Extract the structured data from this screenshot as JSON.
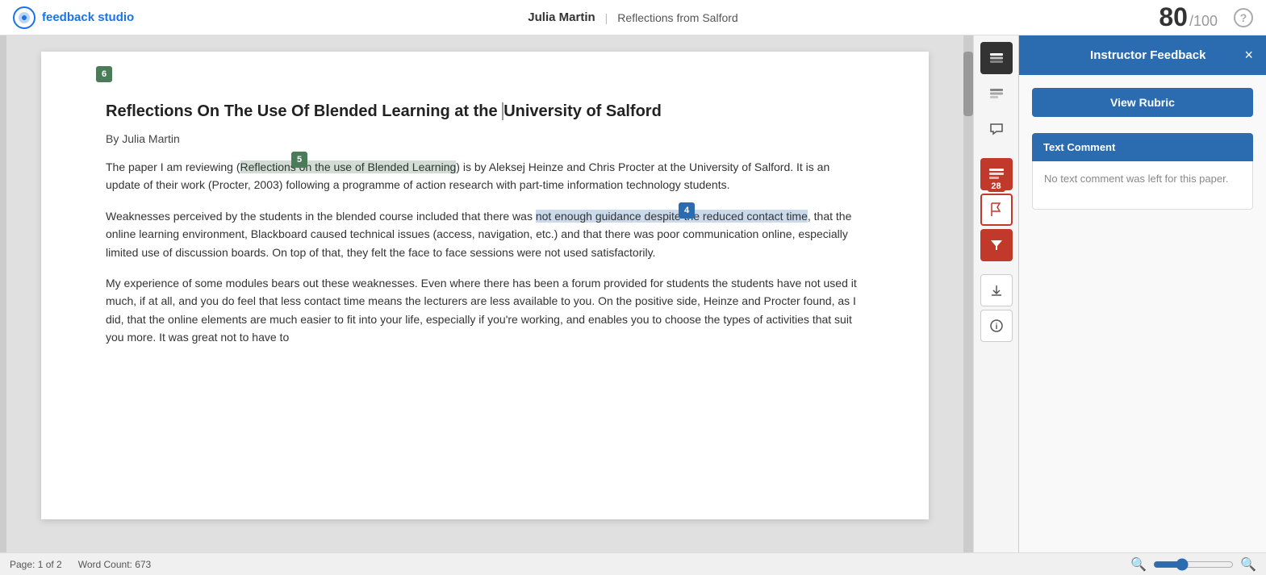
{
  "header": {
    "logo_text": "feedback studio",
    "student_name": "Julia Martin",
    "doc_title": "Reflections from Salford",
    "score": "80",
    "score_total": "/100"
  },
  "toolbar": {
    "layers_icon": "⊞",
    "comments_icon": "💬",
    "rubric_icon": "📊",
    "flag_icon": "⚑",
    "filter_icon": "▼",
    "download_icon": "⬇",
    "info_icon": "ⓘ",
    "badge_count": "28"
  },
  "right_panel": {
    "title": "Instructor Feedback",
    "close_label": "×",
    "view_rubric_label": "View Rubric",
    "text_comment_label": "Text Comment",
    "no_comment_text": "No text comment was left for this paper."
  },
  "document": {
    "badge6_label": "6",
    "badge5_label": "5",
    "badge4_label": "4",
    "title": "Reflections On The Use Of Blended Learning at the University of Salford",
    "author": "By Julia Martin",
    "paragraph1_pre": "The paper I am reviewing (",
    "paragraph1_highlight1": "Reflections on the use of Blended Learning",
    "paragraph1_mid": ") is by Aleksej Heinze and Chris Procter",
    "paragraph1_rest": " at the University of Salford. It is an update of their work (Procter, 2003) following a programme of action research with part-time information technology students.",
    "paragraph2_pre": "Weaknesses perceived by the students in the blended course included that there was ",
    "paragraph2_highlight": "not enough guidance despite the reduced contact time",
    "paragraph2_rest": ", that the online learning environment, Blackboard caused technical issues (access, navigation, etc.)  and that there was poor communication online, especially limited use of discussion boards. On top of that, they felt the face to face sessions were not used satisfactorily.",
    "paragraph3": "My experience of some modules bears out these weaknesses. Even where there has been a forum provided for students the students have not used it much, if at all, and you do feel that less contact time means the lecturers are less available to you.  On the positive side, Heinze and Procter found, as I did, that the online elements are much easier to fit into your life, especially if you're working, and enables you to choose the types of activities that suit you more.  It was great not to have to"
  },
  "footer": {
    "page_info": "Page: 1 of 2",
    "word_count": "Word Count: 673"
  }
}
